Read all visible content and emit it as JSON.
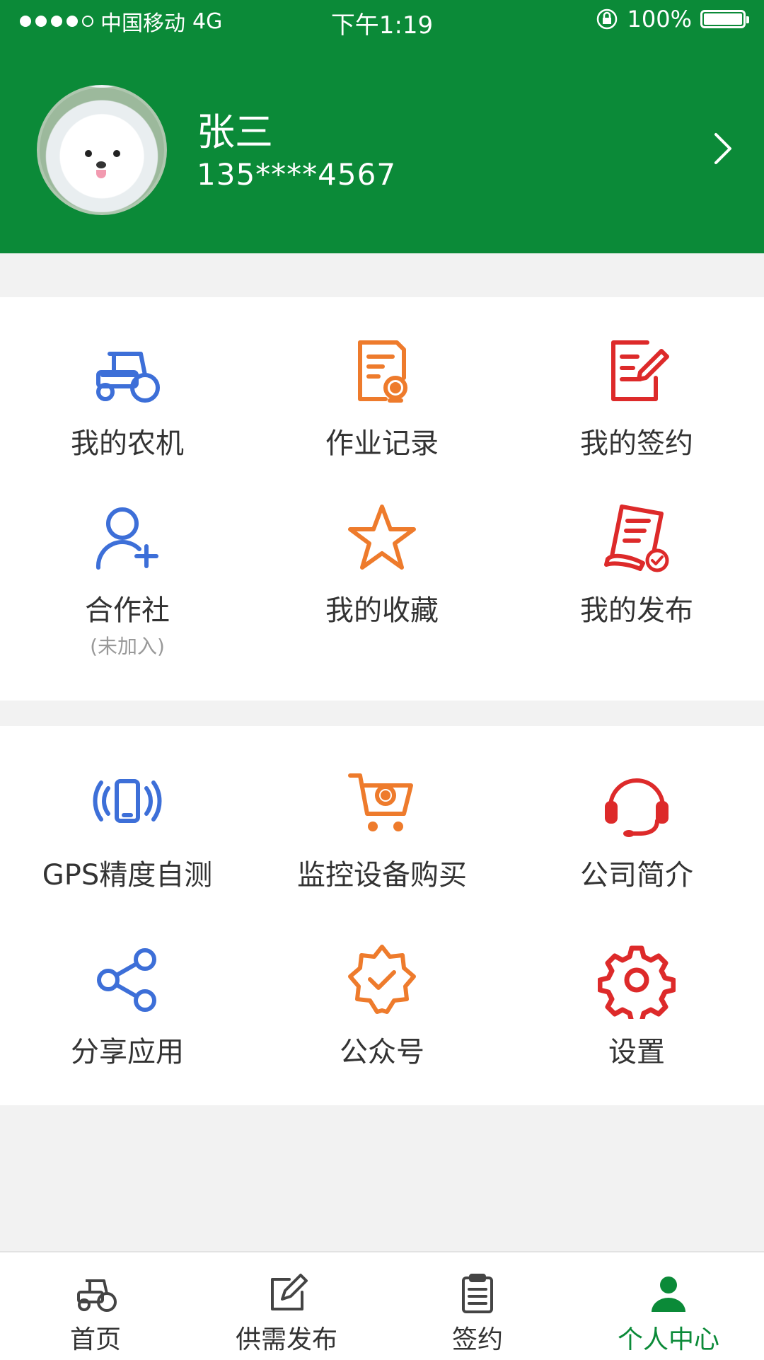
{
  "status_bar": {
    "carrier": "中国移动",
    "network": "4G",
    "time": "下午1:19",
    "battery": "100%"
  },
  "profile": {
    "name": "张三",
    "phone": "135****4567"
  },
  "menu_section_1": [
    {
      "label": "我的农机",
      "icon": "tractor-icon",
      "color": "#3d6fd8"
    },
    {
      "label": "作业记录",
      "icon": "work-record-icon",
      "color": "#ee7b2c"
    },
    {
      "label": "我的签约",
      "icon": "contract-edit-icon",
      "color": "#dd2a2a"
    },
    {
      "label": "合作社",
      "sub": "(未加入)",
      "icon": "add-user-icon",
      "color": "#3d6fd8"
    },
    {
      "label": "我的收藏",
      "icon": "star-icon",
      "color": "#ee7b2c"
    },
    {
      "label": "我的发布",
      "icon": "publish-document-icon",
      "color": "#dd2a2a"
    }
  ],
  "menu_section_2": [
    {
      "label": "GPS精度自测",
      "icon": "phone-signal-icon",
      "color": "#3d6fd8"
    },
    {
      "label": "监控设备购买",
      "icon": "shopping-cart-icon",
      "color": "#ee7b2c"
    },
    {
      "label": "公司简介",
      "icon": "headset-icon",
      "color": "#dd2a2a"
    },
    {
      "label": "分享应用",
      "icon": "share-icon",
      "color": "#3d6fd8"
    },
    {
      "label": "公众号",
      "icon": "badge-check-icon",
      "color": "#ee7b2c"
    },
    {
      "label": "设置",
      "icon": "gear-icon",
      "color": "#dd2a2a"
    }
  ],
  "tabbar": [
    {
      "label": "首页",
      "icon": "tractor-tab-icon",
      "active": false
    },
    {
      "label": "供需发布",
      "icon": "edit-tab-icon",
      "active": false
    },
    {
      "label": "签约",
      "icon": "clipboard-tab-icon",
      "active": false
    },
    {
      "label": "个人中心",
      "icon": "person-tab-icon",
      "active": true
    }
  ],
  "colors": {
    "header_green": "#0b8a38",
    "blue": "#3d6fd8",
    "orange": "#ee7b2c",
    "red": "#dd2a2a"
  }
}
